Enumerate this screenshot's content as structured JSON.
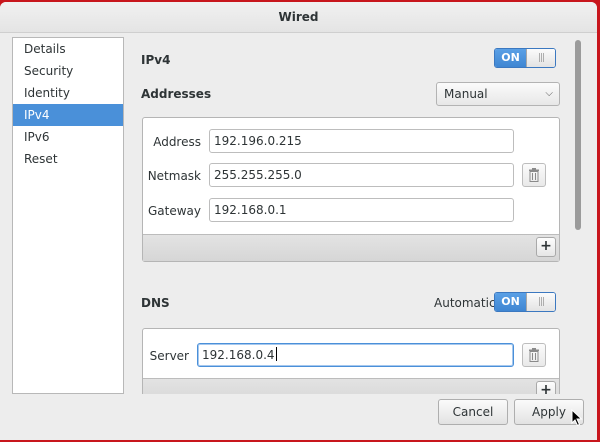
{
  "window": {
    "title": "Wired"
  },
  "sidebar": {
    "items": [
      {
        "label": "Details"
      },
      {
        "label": "Security"
      },
      {
        "label": "Identity"
      },
      {
        "label": "IPv4"
      },
      {
        "label": "IPv6"
      },
      {
        "label": "Reset"
      }
    ],
    "selected": "IPv4"
  },
  "ipv4": {
    "heading": "IPv4",
    "switch_label": "ON",
    "addresses": {
      "heading": "Addresses",
      "method": "Manual",
      "fields": [
        {
          "label": "Address",
          "value": "192.196.0.215"
        },
        {
          "label": "Netmask",
          "value": "255.255.255.0"
        },
        {
          "label": "Gateway",
          "value": "192.168.0.1"
        }
      ],
      "add_label": "+"
    }
  },
  "dns": {
    "heading": "DNS",
    "automatic_label": "Automatic",
    "switch_label": "ON",
    "server": {
      "label": "Server",
      "value": "192.168.0.4"
    },
    "add_label": "+"
  },
  "footer": {
    "cancel_label": "Cancel",
    "apply_label": "Apply"
  },
  "colors": {
    "accent": "#4a90d9",
    "desktop": "#c8161d"
  }
}
